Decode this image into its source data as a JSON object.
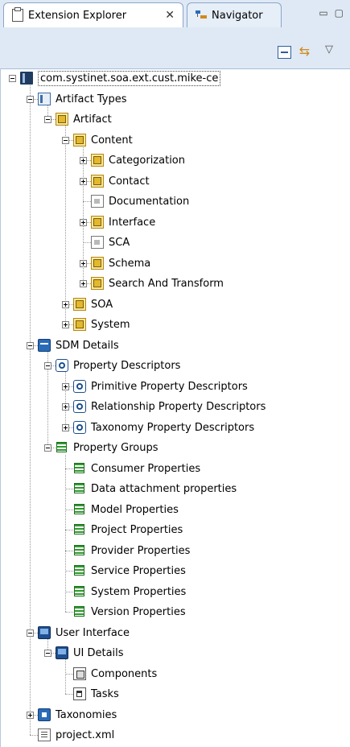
{
  "tabs": [
    {
      "label": "Extension Explorer",
      "close": "✕",
      "icon": "package-explorer-icon"
    },
    {
      "label": "Navigator",
      "icon": "navigator-icon"
    }
  ],
  "view_controls": {
    "minimize": "▭",
    "maximize": "▢"
  },
  "toolbar": {
    "collapse_all": "collapse-all-icon",
    "link_with_editor": "link-with-editor-icon",
    "view_menu": "▽"
  },
  "tree": {
    "nodes": [
      {
        "label": "com.systinet.soa.ext.cust.mike-ce",
        "icon": "project",
        "depth": 0,
        "expander": "minus",
        "selected": true
      },
      {
        "label": "Artifact Types",
        "icon": "book",
        "depth": 1,
        "expander": "minus"
      },
      {
        "label": "Artifact",
        "icon": "artifact",
        "depth": 2,
        "expander": "minus"
      },
      {
        "label": "Content",
        "icon": "artifact",
        "depth": 3,
        "expander": "minus"
      },
      {
        "label": "Categorization",
        "icon": "artifact",
        "depth": 4,
        "expander": "plus"
      },
      {
        "label": "Contact",
        "icon": "artifact",
        "depth": 4,
        "expander": "plus"
      },
      {
        "label": "Documentation",
        "icon": "doc",
        "depth": 4,
        "expander": "none"
      },
      {
        "label": "Interface",
        "icon": "artifact",
        "depth": 4,
        "expander": "plus"
      },
      {
        "label": "SCA",
        "icon": "doc",
        "depth": 4,
        "expander": "none"
      },
      {
        "label": "Schema",
        "icon": "artifact",
        "depth": 4,
        "expander": "plus"
      },
      {
        "label": "Search And Transform",
        "icon": "artifact",
        "depth": 4,
        "expander": "plus"
      },
      {
        "label": "SOA",
        "icon": "artifact",
        "depth": 3,
        "expander": "plus"
      },
      {
        "label": "System",
        "icon": "artifact",
        "depth": 3,
        "expander": "plus"
      },
      {
        "label": "SDM Details",
        "icon": "folder",
        "depth": 1,
        "expander": "minus"
      },
      {
        "label": "Property Descriptors",
        "icon": "prop",
        "depth": 2,
        "expander": "minus"
      },
      {
        "label": "Primitive Property Descriptors",
        "icon": "prop",
        "depth": 3,
        "expander": "plus"
      },
      {
        "label": "Relationship Property Descriptors",
        "icon": "prop",
        "depth": 3,
        "expander": "plus"
      },
      {
        "label": "Taxonomy Property Descriptors",
        "icon": "prop",
        "depth": 3,
        "expander": "plus"
      },
      {
        "label": "Property Groups",
        "icon": "group",
        "depth": 2,
        "expander": "minus"
      },
      {
        "label": "Consumer Properties",
        "icon": "group",
        "depth": 3,
        "expander": "none"
      },
      {
        "label": "Data attachment properties",
        "icon": "group",
        "depth": 3,
        "expander": "none"
      },
      {
        "label": "Model Properties",
        "icon": "group",
        "depth": 3,
        "expander": "none"
      },
      {
        "label": "Project Properties",
        "icon": "group",
        "depth": 3,
        "expander": "none"
      },
      {
        "label": "Provider Properties",
        "icon": "group",
        "depth": 3,
        "expander": "none"
      },
      {
        "label": "Service Properties",
        "icon": "group",
        "depth": 3,
        "expander": "none"
      },
      {
        "label": "System Properties",
        "icon": "group",
        "depth": 3,
        "expander": "none"
      },
      {
        "label": "Version Properties",
        "icon": "group",
        "depth": 3,
        "expander": "none"
      },
      {
        "label": "User Interface",
        "icon": "monitor",
        "depth": 1,
        "expander": "minus"
      },
      {
        "label": "UI Details",
        "icon": "monitor",
        "depth": 2,
        "expander": "minus"
      },
      {
        "label": "Components",
        "icon": "comp",
        "depth": 3,
        "expander": "none"
      },
      {
        "label": "Tasks",
        "icon": "task",
        "depth": 3,
        "expander": "none"
      },
      {
        "label": "Taxonomies",
        "icon": "tax",
        "depth": 1,
        "expander": "plus"
      },
      {
        "label": "project.xml",
        "icon": "xml",
        "depth": 1,
        "expander": "none"
      }
    ]
  }
}
